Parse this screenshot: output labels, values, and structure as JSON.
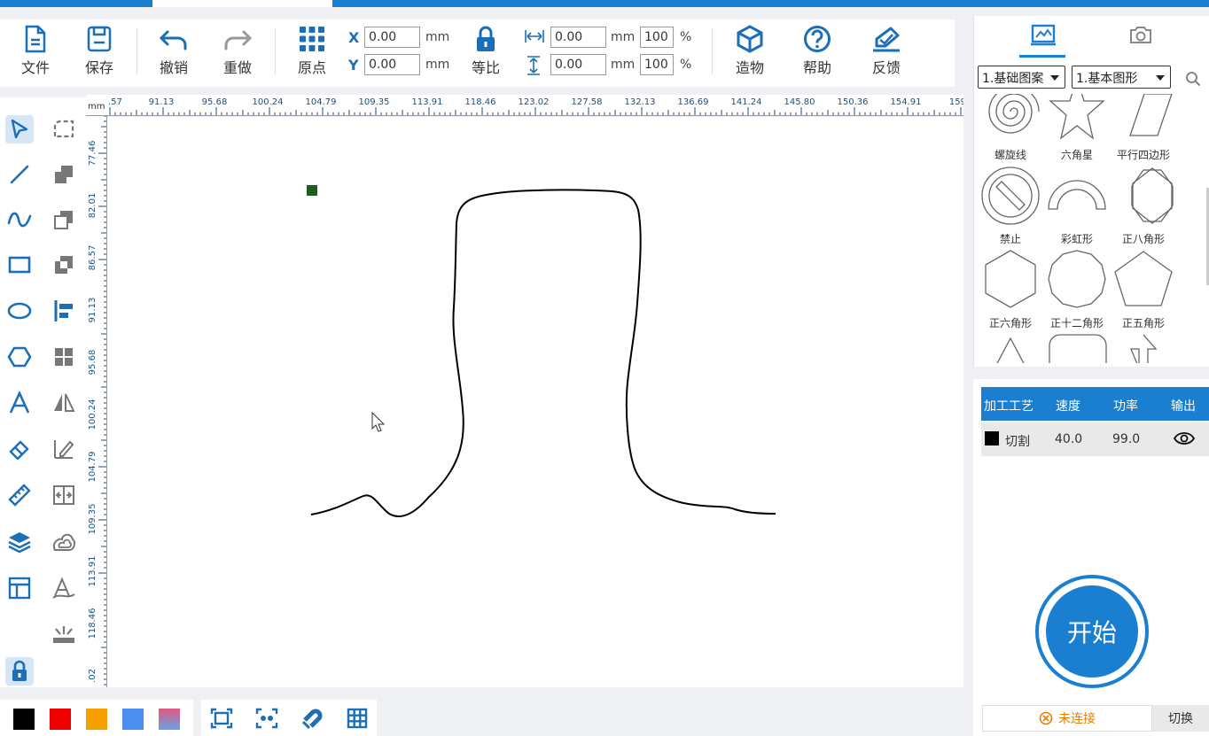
{
  "toolbar": {
    "file": "文件",
    "save": "保存",
    "undo": "撤销",
    "redo": "重做",
    "origin": "原点",
    "x_label": "X",
    "y_label": "Y",
    "x_value": "0.00",
    "y_value": "0.00",
    "unit": "mm",
    "lock_ratio": "等比",
    "width_value": "0.00",
    "height_value": "0.00",
    "width_pct": "100",
    "height_pct": "100",
    "pct": "%",
    "create": "造物",
    "help": "帮助",
    "feedback": "反馈"
  },
  "ruler": {
    "unit": "mm",
    "h_ticks": [
      ".57",
      "91.13",
      "95.68",
      "100.24",
      "104.79",
      "109.35",
      "113.91",
      "118.46",
      "123.02",
      "127.58",
      "132.13",
      "136.69",
      "141.24",
      "145.80",
      "150.36",
      "154.91",
      "159."
    ],
    "v_ticks": [
      "77.46",
      "82.01",
      "86.57",
      "91.13",
      "95.68",
      "100.24",
      "104.79",
      "109.35",
      "113.91",
      "118.46",
      ".02"
    ]
  },
  "colors": {
    "accent": "#1a7fd0",
    "swatches": [
      "#000000",
      "#ee0000",
      "#f5a000",
      "#4a8ff0",
      "gradient"
    ]
  },
  "library": {
    "category": "1.基础图案",
    "subcategory": "1.基本图形",
    "shapes": [
      "螺旋线",
      "六角星",
      "平行四边形",
      "禁止",
      "彩虹形",
      "正八角形",
      "正六角形",
      "正十二角形",
      "正五角形"
    ]
  },
  "layers": {
    "headers": [
      "加工工艺",
      "速度",
      "功率",
      "输出"
    ],
    "rows": [
      {
        "process": "切割",
        "speed": "40.0",
        "power": "99.0",
        "color": "#000000"
      }
    ]
  },
  "start_label": "开始",
  "status": {
    "connection": "未连接",
    "switch": "切换"
  }
}
